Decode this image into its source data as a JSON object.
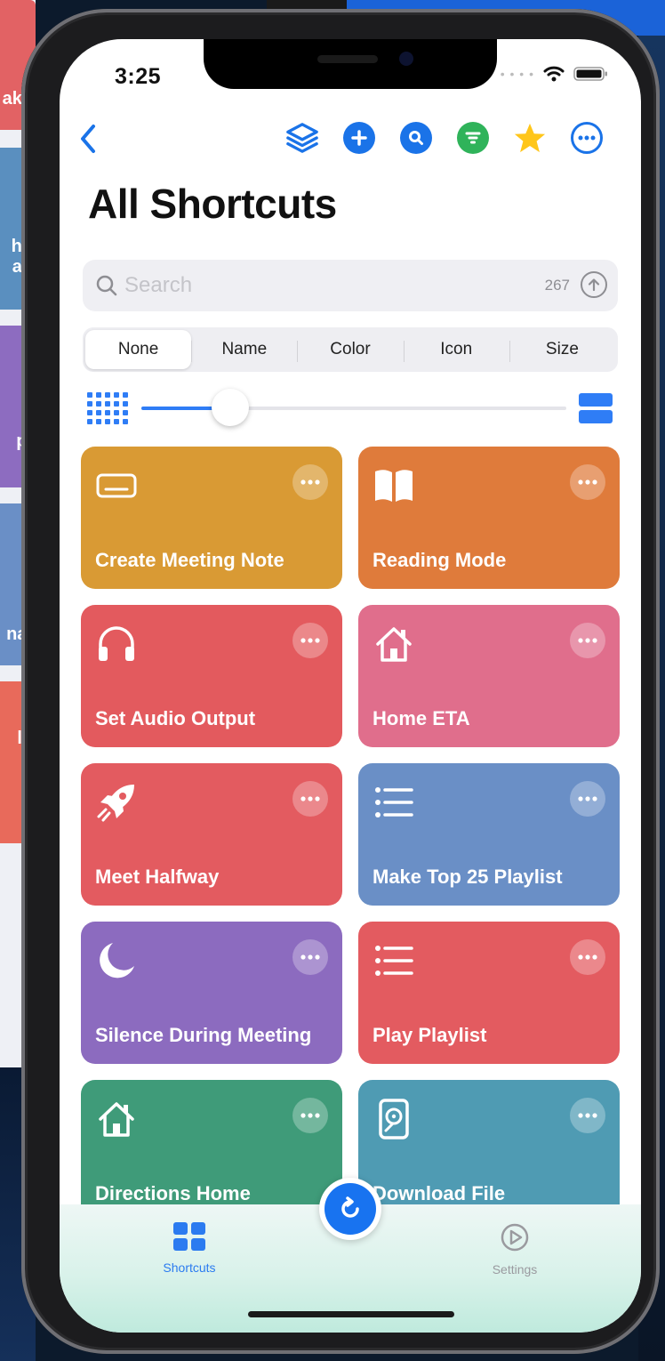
{
  "status_bar": {
    "time": "3:25"
  },
  "nav": {
    "page_title": "All Shortcuts"
  },
  "search": {
    "placeholder": "Search",
    "count": "267"
  },
  "segmented": {
    "options": [
      "None",
      "Name",
      "Color",
      "Icon",
      "Size"
    ],
    "selected": "None"
  },
  "slider": {
    "value_fraction": 0.21
  },
  "shortcuts": [
    {
      "title": "Create Meeting Note",
      "color": "#d99a34",
      "icon": "keyboard-icon"
    },
    {
      "title": "Reading Mode",
      "color": "#df7b3b",
      "icon": "book-icon"
    },
    {
      "title": "Set Audio Output",
      "color": "#e35a5e",
      "icon": "headphones-icon"
    },
    {
      "title": "Home ETA",
      "color": "#e06e8c",
      "icon": "house-icon"
    },
    {
      "title": "Meet Halfway",
      "color": "#e35b60",
      "icon": "rocket-icon"
    },
    {
      "title": "Make Top 25 Playlist",
      "color": "#6a8fc6",
      "icon": "list-icon"
    },
    {
      "title": "Silence During Meeting",
      "color": "#8c6bbf",
      "icon": "moon-icon"
    },
    {
      "title": "Play Playlist",
      "color": "#e35b60",
      "icon": "list-icon"
    },
    {
      "title": "Directions Home",
      "color": "#3f9b79",
      "icon": "house-icon"
    },
    {
      "title": "Download File",
      "color": "#4f9bb3",
      "icon": "hard-drive-icon"
    }
  ],
  "tabbar": {
    "shortcuts_label": "Shortcuts",
    "settings_label": "Settings",
    "active_color": "#2b7bf0",
    "inactive_color": "#9a9a9f"
  },
  "background_cards": [
    {
      "text": "ake",
      "color": "#e26264"
    },
    {
      "text": "he av",
      "color": "#5a8fbf"
    },
    {
      "text": "p pl",
      "color": "#8d6cc0"
    },
    {
      "text": "nai",
      "color": "#6a8fc6"
    },
    {
      "text": "p lk",
      "color": "#e86a5b"
    }
  ]
}
